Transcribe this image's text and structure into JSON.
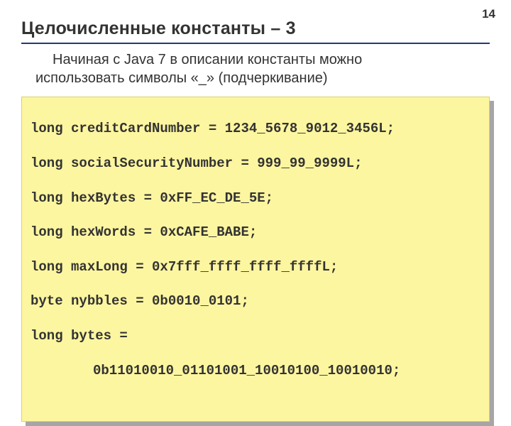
{
  "page_number": "14",
  "title": "Целочисленные константы – 3",
  "body": {
    "line1": "Начиная с Java 7 в описании константы можно",
    "line2": "использовать символы «_» (подчеркивание)"
  },
  "code": {
    "lines": [
      "long creditCardNumber = 1234_5678_9012_3456L;",
      "long socialSecurityNumber = 999_99_9999L;",
      "long hexBytes = 0xFF_EC_DE_5E;",
      "long hexWords = 0xCAFE_BABE;",
      "long maxLong = 0x7fff_ffff_ffff_ffffL;",
      "byte nybbles = 0b0010_0101;",
      "long bytes =",
      "0b11010010_01101001_10010100_10010010;"
    ]
  }
}
